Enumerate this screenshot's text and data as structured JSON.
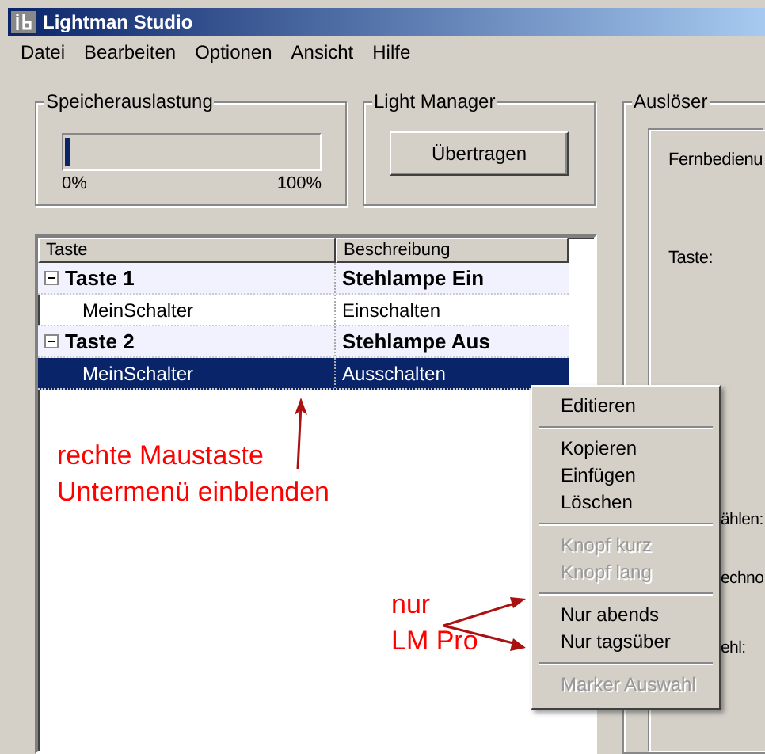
{
  "window": {
    "title": "Lightman Studio"
  },
  "menu_bar": [
    "Datei",
    "Bearbeiten",
    "Optionen",
    "Ansicht",
    "Hilfe"
  ],
  "memory": {
    "title": "Speicherauslastung",
    "level": 0.02,
    "min_label": "0%",
    "max_label": "100%"
  },
  "light_manager": {
    "title": "Light Manager",
    "button": "Übertragen"
  },
  "tree": {
    "columns": [
      "Taste",
      "Beschreibung"
    ],
    "rows": [
      {
        "label": "Taste 1",
        "description": "Stehlampe Ein",
        "expanded": true,
        "selected": false,
        "children": [
          {
            "label": "MeinSchalter",
            "description": "Einschalten",
            "selected": false
          }
        ]
      },
      {
        "label": "Taste 2",
        "description": "Stehlampe Aus",
        "expanded": true,
        "selected": false,
        "children": [
          {
            "label": "MeinSchalter",
            "description": "Ausschalten",
            "selected": true
          }
        ]
      }
    ]
  },
  "trigger": {
    "title": "Auslöser",
    "remote_label": "Fernbedienu",
    "key_label": "Taste:",
    "labels": [
      "ählen:",
      "echno",
      "ehl:"
    ]
  },
  "context_menu": [
    {
      "kind": "item",
      "label": "Editieren",
      "disabled": false
    },
    {
      "kind": "separator"
    },
    {
      "kind": "item",
      "label": "Kopieren",
      "disabled": false
    },
    {
      "kind": "item",
      "label": "Einfügen",
      "disabled": false
    },
    {
      "kind": "item",
      "label": "Löschen",
      "disabled": false
    },
    {
      "kind": "separator"
    },
    {
      "kind": "item",
      "label": "Knopf kurz",
      "disabled": true
    },
    {
      "kind": "item",
      "label": "Knopf lang",
      "disabled": true
    },
    {
      "kind": "separator"
    },
    {
      "kind": "item",
      "label": "Nur abends",
      "disabled": false
    },
    {
      "kind": "item",
      "label": "Nur tagsüber",
      "disabled": false
    },
    {
      "kind": "separator"
    },
    {
      "kind": "item",
      "label": "Marker Auswahl",
      "disabled": true
    }
  ],
  "annotations": [
    {
      "lines": [
        "rechte Maustaste",
        "Untermenü einblenden"
      ]
    },
    {
      "lines": [
        "nur",
        "LM Pro"
      ]
    }
  ]
}
